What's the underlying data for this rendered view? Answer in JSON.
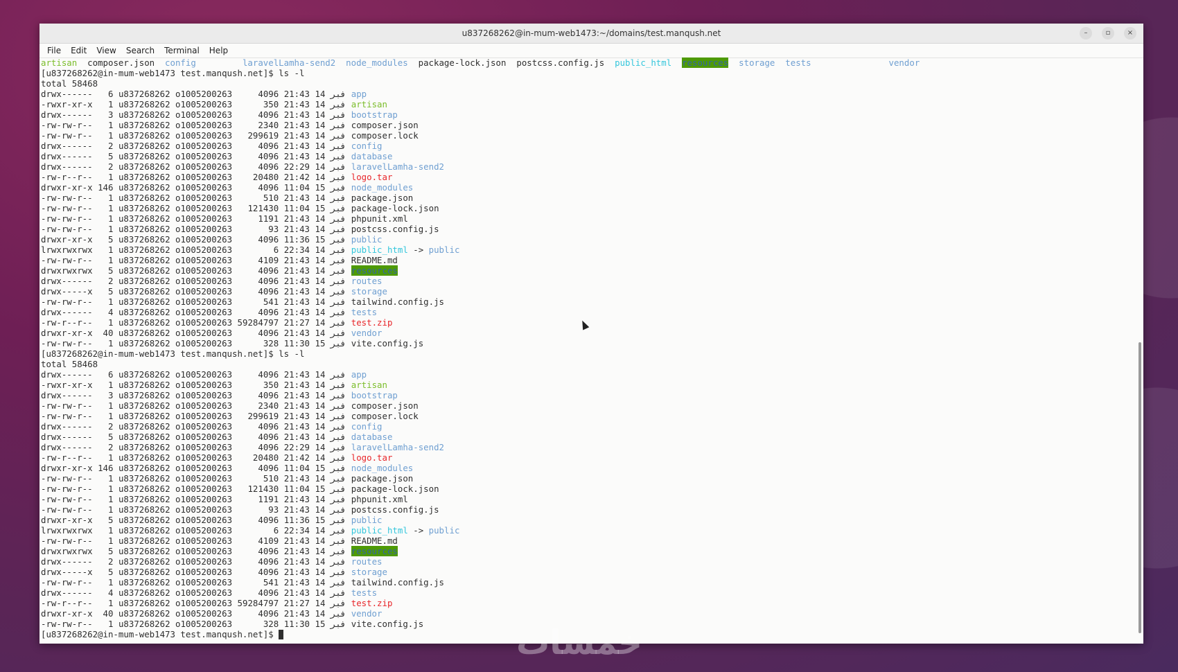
{
  "window": {
    "title": "u837268262@in-mum-web1473:~/domains/test.manqush.net",
    "minimize": "–",
    "maximize": "▫",
    "close": "×"
  },
  "menu": [
    "File",
    "Edit",
    "View",
    "Search",
    "Terminal",
    "Help"
  ],
  "colors": {
    "dir": "#6f9fd1",
    "exec": "#7bbd2a",
    "archive": "#e8262a",
    "symlink": "#34c6dc",
    "sticky_bg": "#4e9a06"
  },
  "ls_columns": [
    {
      "name": "artisan",
      "type": "exec"
    },
    {
      "name": "composer.json",
      "type": "file"
    },
    {
      "name": "config",
      "type": "dir"
    },
    {
      "name": "laravelLamha-send2",
      "type": "dir"
    },
    {
      "name": "node_modules",
      "type": "dir"
    },
    {
      "name": "package-lock.json",
      "type": "file"
    },
    {
      "name": "postcss.config.js",
      "type": "file"
    },
    {
      "name": "public_html",
      "type": "lnk"
    },
    {
      "name": "resources",
      "type": "sticky"
    },
    {
      "name": "storage",
      "type": "dir"
    },
    {
      "name": "tests",
      "type": "dir"
    },
    {
      "name": "vendor",
      "type": "dir"
    }
  ],
  "prompt": "[u837268262@in-mum-web1473 test.manqush.net]$ ",
  "command": "ls -l",
  "total": "total 58468",
  "owner": "u837268262",
  "group": "o1005200263",
  "month": "فبر",
  "entries": [
    {
      "perm": "drwx------",
      "links": "6",
      "size": "4096",
      "time": "21:43",
      "day": "14",
      "name": "app",
      "type": "dir"
    },
    {
      "perm": "-rwxr-xr-x",
      "links": "1",
      "size": "350",
      "time": "21:43",
      "day": "14",
      "name": "artisan",
      "type": "exec"
    },
    {
      "perm": "drwx------",
      "links": "3",
      "size": "4096",
      "time": "21:43",
      "day": "14",
      "name": "bootstrap",
      "type": "dir"
    },
    {
      "perm": "-rw-rw-r--",
      "links": "1",
      "size": "2340",
      "time": "21:43",
      "day": "14",
      "name": "composer.json",
      "type": "file"
    },
    {
      "perm": "-rw-rw-r--",
      "links": "1",
      "size": "299619",
      "time": "21:43",
      "day": "14",
      "name": "composer.lock",
      "type": "file"
    },
    {
      "perm": "drwx------",
      "links": "2",
      "size": "4096",
      "time": "21:43",
      "day": "14",
      "name": "config",
      "type": "dir"
    },
    {
      "perm": "drwx------",
      "links": "5",
      "size": "4096",
      "time": "21:43",
      "day": "14",
      "name": "database",
      "type": "dir"
    },
    {
      "perm": "drwx------",
      "links": "2",
      "size": "4096",
      "time": "22:29",
      "day": "14",
      "name": "laravelLamha-send2",
      "type": "dir"
    },
    {
      "perm": "-rw-r--r--",
      "links": "1",
      "size": "20480",
      "time": "21:42",
      "day": "14",
      "name": "logo.tar",
      "type": "arc"
    },
    {
      "perm": "drwxr-xr-x",
      "links": "146",
      "size": "4096",
      "time": "11:04",
      "day": "15",
      "name": "node_modules",
      "type": "dir"
    },
    {
      "perm": "-rw-rw-r--",
      "links": "1",
      "size": "510",
      "time": "21:43",
      "day": "14",
      "name": "package.json",
      "type": "file"
    },
    {
      "perm": "-rw-rw-r--",
      "links": "1",
      "size": "121430",
      "time": "11:04",
      "day": "15",
      "name": "package-lock.json",
      "type": "file"
    },
    {
      "perm": "-rw-rw-r--",
      "links": "1",
      "size": "1191",
      "time": "21:43",
      "day": "14",
      "name": "phpunit.xml",
      "type": "file"
    },
    {
      "perm": "-rw-rw-r--",
      "links": "1",
      "size": "93",
      "time": "21:43",
      "day": "14",
      "name": "postcss.config.js",
      "type": "file"
    },
    {
      "perm": "drwxr-xr-x",
      "links": "5",
      "size": "4096",
      "time": "11:36",
      "day": "15",
      "name": "public",
      "type": "dir"
    },
    {
      "perm": "lrwxrwxrwx",
      "links": "1",
      "size": "6",
      "time": "22:34",
      "day": "14",
      "name": "public_html",
      "type": "lnk",
      "arrow": " -> ",
      "target": "public"
    },
    {
      "perm": "-rw-rw-r--",
      "links": "1",
      "size": "4109",
      "time": "21:43",
      "day": "14",
      "name": "README.md",
      "type": "file"
    },
    {
      "perm": "drwxrwxrwx",
      "links": "5",
      "size": "4096",
      "time": "21:43",
      "day": "14",
      "name": "resources",
      "type": "sticky"
    },
    {
      "perm": "drwx------",
      "links": "2",
      "size": "4096",
      "time": "21:43",
      "day": "14",
      "name": "routes",
      "type": "dir"
    },
    {
      "perm": "drwx-----x",
      "links": "5",
      "size": "4096",
      "time": "21:43",
      "day": "14",
      "name": "storage",
      "type": "dir"
    },
    {
      "perm": "-rw-rw-r--",
      "links": "1",
      "size": "541",
      "time": "21:43",
      "day": "14",
      "name": "tailwind.config.js",
      "type": "file"
    },
    {
      "perm": "drwx------",
      "links": "4",
      "size": "4096",
      "time": "21:43",
      "day": "14",
      "name": "tests",
      "type": "dir"
    },
    {
      "perm": "-rw-r--r--",
      "links": "1",
      "size": "59284797",
      "time": "21:27",
      "day": "14",
      "name": "test.zip",
      "type": "arc"
    },
    {
      "perm": "drwxr-xr-x",
      "links": "40",
      "size": "4096",
      "time": "21:43",
      "day": "14",
      "name": "vendor",
      "type": "dir"
    },
    {
      "perm": "-rw-rw-r--",
      "links": "1",
      "size": "328",
      "time": "11:30",
      "day": "15",
      "name": "vite.config.js",
      "type": "file"
    }
  ],
  "watermark": "خمسات"
}
